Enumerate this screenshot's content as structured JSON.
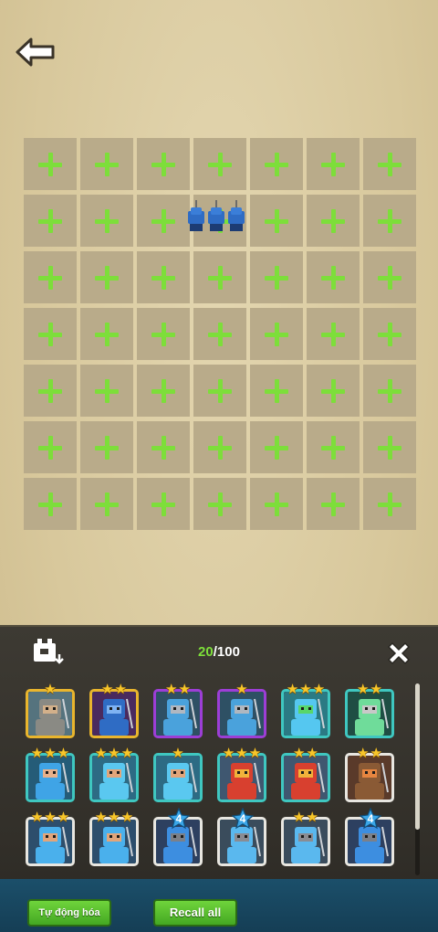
{
  "header": {
    "back_icon": "back-arrow-icon"
  },
  "battlefield": {
    "rows": 7,
    "cols": 7,
    "empty_slot_icon": "plus-icon",
    "placed_units": [
      {
        "row": 2,
        "col": 4,
        "unit": "blue-spearman-squad"
      }
    ]
  },
  "army_panel": {
    "count_current": "20",
    "count_separator": "/",
    "count_max": "100",
    "box_icon": "unit-box-icon",
    "close_icon": "close-icon",
    "cards": [
      {
        "frame": "gold",
        "stars": 1,
        "art": "gray-rock-golem"
      },
      {
        "frame": "gold",
        "stars": 2,
        "art": "blue-demon-knight"
      },
      {
        "frame": "purple",
        "stars": 2,
        "art": "blue-armored-swordsman"
      },
      {
        "frame": "purple",
        "stars": 1,
        "art": "blue-armored-swordsman"
      },
      {
        "frame": "teal",
        "stars": 3,
        "art": "blue-helmeted-warrior"
      },
      {
        "frame": "teal",
        "stars": 2,
        "art": "green-dual-blade"
      },
      {
        "frame": "teal",
        "stars": 3,
        "art": "blue-hair-fighter"
      },
      {
        "frame": "teal",
        "stars": 3,
        "art": "blue-brawler"
      },
      {
        "frame": "teal",
        "stars": 1,
        "art": "blue-brawler"
      },
      {
        "frame": "teal",
        "stars": 3,
        "art": "red-caster"
      },
      {
        "frame": "teal",
        "stars": 2,
        "art": "red-caster"
      },
      {
        "frame": "white",
        "stars": 2,
        "art": "cannon-crew"
      },
      {
        "frame": "white",
        "stars": 3,
        "art": "blue-soldier"
      },
      {
        "frame": "white",
        "stars": 3,
        "art": "blue-soldier"
      },
      {
        "frame": "white",
        "badge": "4",
        "art": "blue-knight"
      },
      {
        "frame": "white",
        "badge": "4",
        "art": "gray-helmet-soldier"
      },
      {
        "frame": "white",
        "stars": 2,
        "art": "gray-helmet-soldier"
      },
      {
        "frame": "white",
        "badge": "4",
        "art": "blue-knight"
      }
    ]
  },
  "bottom_bar": {
    "auto_label": "Tự động hóa",
    "recall_label": "Recall all"
  },
  "colors": {
    "plus": "#7dde3a",
    "cell": "#b9ab8a",
    "gold_frame": "#e9b52d",
    "purple_frame": "#9d3ed6",
    "teal_frame": "#3fc7c0",
    "button_green": "#5cc02f"
  }
}
